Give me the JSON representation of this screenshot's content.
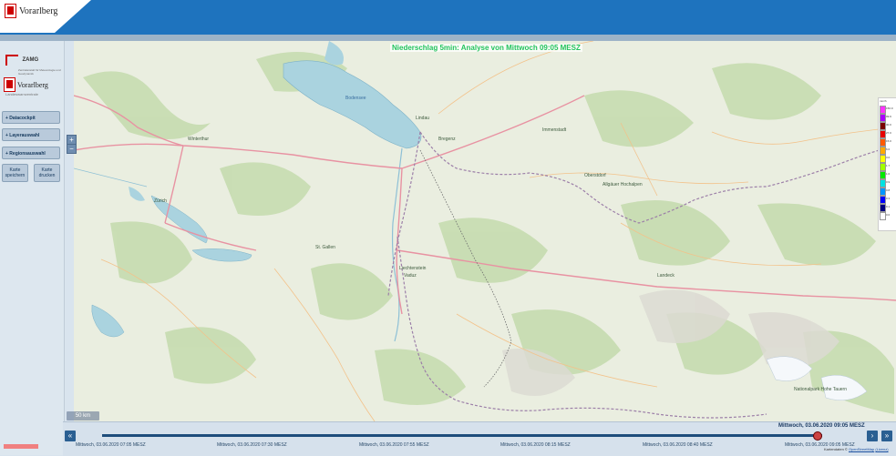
{
  "header": {
    "logo_text": "Vorarlberg"
  },
  "sidebar": {
    "zamg_text": "ZAMG",
    "zamg_subtext": "Zentralanstalt für Meteorologie und Geodynamik",
    "logo_text": "Vorarlberg",
    "logo_subtitle": "Landeswarnzentrale",
    "buttons": [
      {
        "label": "+ Datacockpit"
      },
      {
        "label": "+ Layerauswahl"
      },
      {
        "label": "+ Regionsauswahl"
      }
    ],
    "save_map_label": "Karte speichern",
    "print_map_label": "Karte drucken"
  },
  "map": {
    "title": "Niederschlag 5min: Analyse von Mittwoch 09:05 MESZ",
    "zoom_in": "+",
    "zoom_out": "−",
    "scale_label": "50 km",
    "places": [
      {
        "name": "Winterthur"
      },
      {
        "name": "Zürich"
      },
      {
        "name": "St. Gallen"
      },
      {
        "name": "Lindau"
      },
      {
        "name": "Bregenz"
      },
      {
        "name": "Liechtenstein"
      },
      {
        "name": "Vaduz"
      },
      {
        "name": "Immenstadt"
      },
      {
        "name": "Oberstdorf"
      },
      {
        "name": "Allgäuer Hochalpen"
      },
      {
        "name": "Landeck"
      },
      {
        "name": "Nationalpark Hohe Tauern"
      }
    ],
    "lake_label": "Bodensee"
  },
  "legend": {
    "unit": "mm/h",
    "colors": [
      "#ff33ff",
      "#aa00ff",
      "#7a0000",
      "#e60000",
      "#ff5a00",
      "#ffaa00",
      "#ffff00",
      "#a0ff00",
      "#00e800",
      "#00e1e1",
      "#0096ff",
      "#0000fa",
      "#000080",
      "#ffffff"
    ],
    "labels": [
      "150.0",
      "99.9",
      "30.0",
      "27.0",
      "15.0",
      "6.0",
      "3.0",
      "1.7",
      "1.0",
      "0.9",
      "0.8",
      "0.3",
      "0.1",
      "0.0"
    ]
  },
  "timebar": {
    "current": "Mittwoch, 03.06.2020 09:05 MESZ",
    "ticks": [
      {
        "label": "Mittwoch, 03.06.2020 07:05 MESZ"
      },
      {
        "label": "Mittwoch, 03.06.2020 07:30 MESZ"
      },
      {
        "label": "Mittwoch, 03.06.2020 07:55 MESZ"
      },
      {
        "label": "Mittwoch, 03.06.2020 08:15 MESZ"
      },
      {
        "label": "Mittwoch, 03.06.2020 08:40 MESZ"
      },
      {
        "label": "Mittwoch, 03.06.2020 09:05 MESZ"
      }
    ],
    "first_label": "«",
    "prev_label": "‹",
    "next_label": "›",
    "last_label": "»",
    "attribution_prefix": "Kartendaten ©",
    "attribution_link": "OpenStreetMap",
    "attribution_license": "(Lizenz)"
  }
}
